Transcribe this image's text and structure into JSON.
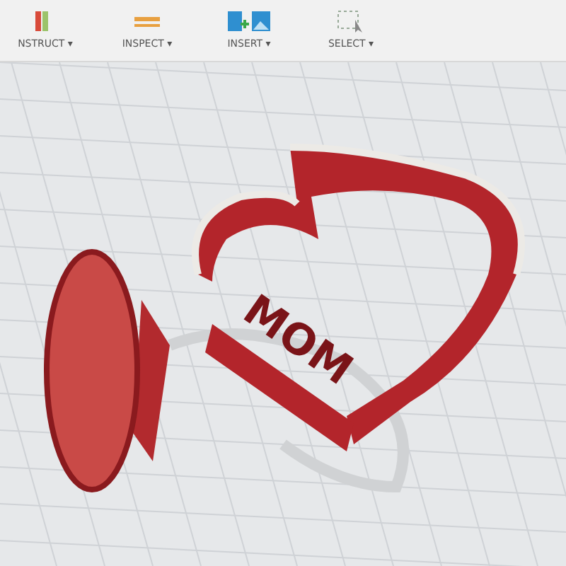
{
  "toolbar": [
    {
      "label": "NSTRUCT ▾",
      "kind": "construct"
    },
    {
      "label": "INSPECT ▾",
      "kind": "inspect"
    },
    {
      "label": "INSERT ▾",
      "kind": "insert"
    },
    {
      "label": "SELECT ▾",
      "kind": "select"
    }
  ],
  "model": {
    "lettering": "MOM"
  }
}
